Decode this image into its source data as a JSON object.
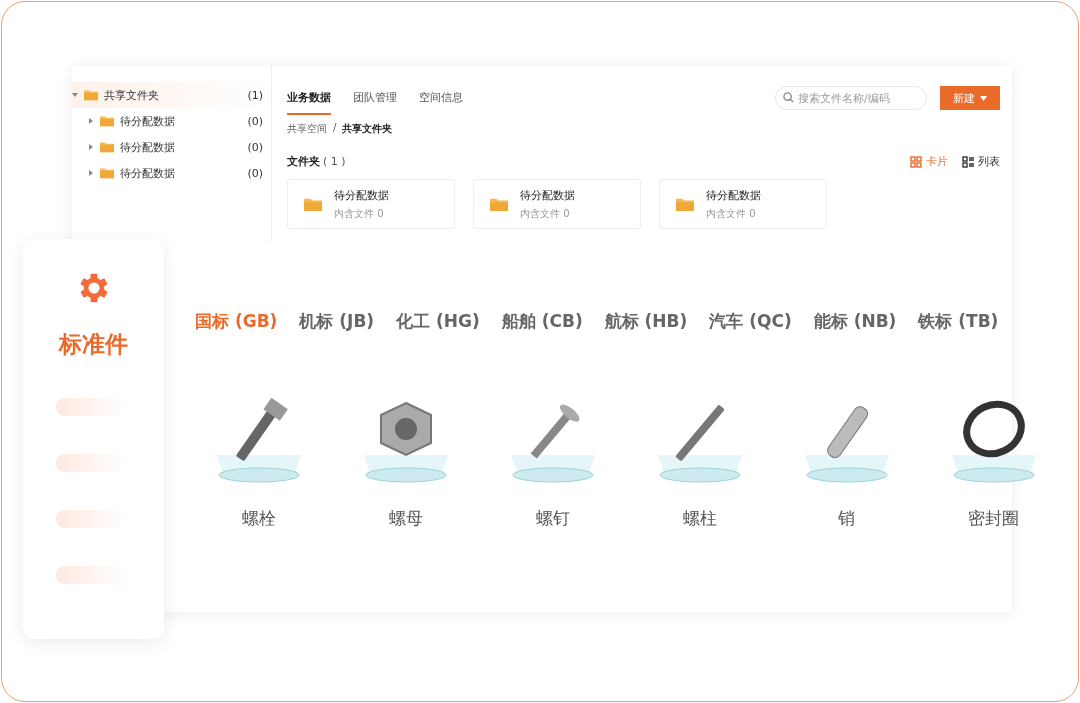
{
  "tree": {
    "label": "共享文件夹",
    "count": "(1)",
    "expanded": true,
    "selected": true,
    "children": [
      {
        "label": "待分配数据",
        "count": "(0)",
        "expanded": false,
        "selected": false
      },
      {
        "label": "待分配数据",
        "count": "(0)",
        "expanded": false,
        "selected": false
      },
      {
        "label": "待分配数据",
        "count": "(0)",
        "expanded": false,
        "selected": false
      }
    ]
  },
  "nav_tabs": [
    {
      "label": "业务数据",
      "selected": true
    },
    {
      "label": "团队管理",
      "selected": false
    },
    {
      "label": "空间信息",
      "selected": false
    }
  ],
  "search": {
    "placeholder": "搜索文件名称/编码"
  },
  "new_button": {
    "label": "新建"
  },
  "breadcrumb": {
    "items": [
      "共享空间",
      "共享文件夹"
    ],
    "separator": "/"
  },
  "folder_section": {
    "title": "文件夹",
    "count": "( 1 )"
  },
  "view_toggles": [
    {
      "label": "卡片",
      "kind": "card",
      "selected": true
    },
    {
      "label": "列表",
      "kind": "list",
      "selected": false
    }
  ],
  "folders": [
    {
      "name": "待分配数据",
      "meta": "内含文件 0"
    },
    {
      "name": "待分配数据",
      "meta": "内含文件 0"
    },
    {
      "name": "待分配数据",
      "meta": "内含文件 0"
    }
  ],
  "side_card": {
    "title": "标准件"
  },
  "standard_tabs": [
    {
      "label": "国标 (GB)",
      "selected": true
    },
    {
      "label": "机标 (JB)",
      "selected": false
    },
    {
      "label": "化工 (HG)",
      "selected": false
    },
    {
      "label": "船舶 (CB)",
      "selected": false
    },
    {
      "label": "航标 (HB)",
      "selected": false
    },
    {
      "label": "汽车 (QC)",
      "selected": false
    },
    {
      "label": "能标 (NB)",
      "selected": false
    },
    {
      "label": "铁标 (TB)",
      "selected": false
    }
  ],
  "parts": [
    {
      "name": "螺栓",
      "kind": "bolt"
    },
    {
      "name": "螺母",
      "kind": "nut"
    },
    {
      "name": "螺钉",
      "kind": "screw"
    },
    {
      "name": "螺柱",
      "kind": "stud"
    },
    {
      "name": "销",
      "kind": "pin"
    },
    {
      "name": "密封圈",
      "kind": "ring"
    }
  ]
}
